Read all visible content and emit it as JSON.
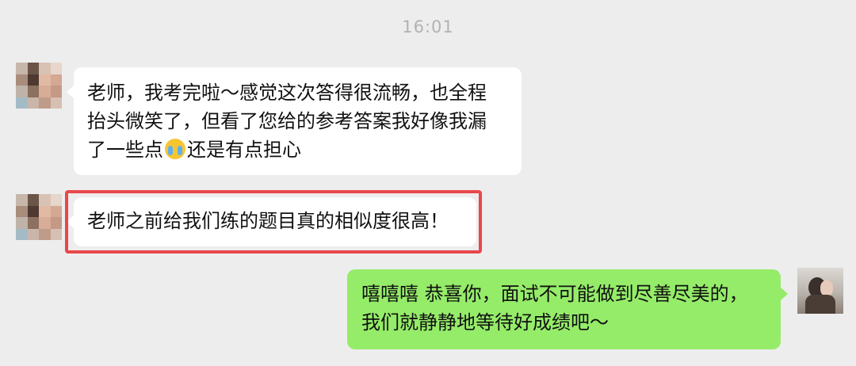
{
  "timestamp": "16:01",
  "messages": [
    {
      "sender": "contact",
      "lines": [
        "老师，我考完啦～感觉这次答得很流畅，也全程",
        "抬头微笑了，但看了您给的参考答案我好像我漏"
      ],
      "line3_before": "了一些点",
      "emoji": "crying-face-icon",
      "line3_after": "还是有点担心"
    },
    {
      "sender": "contact",
      "text": "老师之前给我们练的题目真的相似度很高！",
      "highlighted": true,
      "highlight_color": "#e8474c"
    },
    {
      "sender": "me",
      "lines": [
        "嘻嘻嘻 恭喜你，面试不可能做到尽善尽美的，",
        "我们就静静地等待好成绩吧～"
      ]
    }
  ],
  "colors": {
    "background": "#ededed",
    "incoming_bubble": "#ffffff",
    "outgoing_bubble": "#95ec69"
  }
}
